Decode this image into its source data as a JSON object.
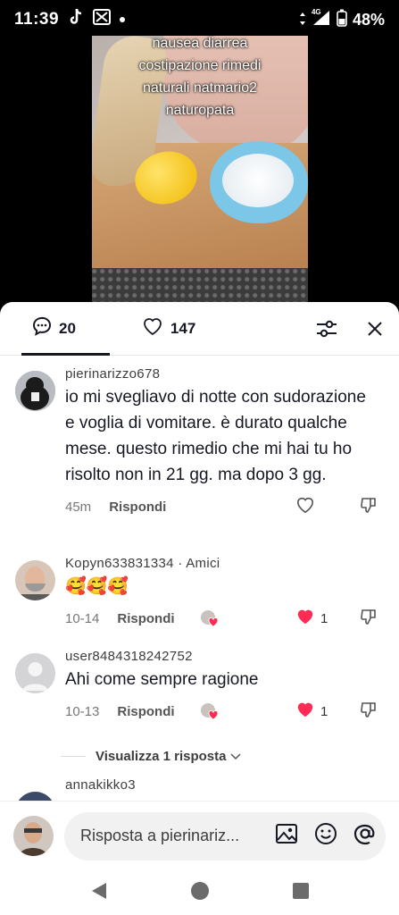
{
  "status_bar": {
    "time": "11:39",
    "network": "4G",
    "battery": "48%"
  },
  "video": {
    "caption_lines": [
      "nausea diarrea",
      "costipazione rimedi",
      "naturali natmario2",
      "naturopata"
    ]
  },
  "header": {
    "comments_count": "20",
    "likes_count": "147"
  },
  "comments": [
    {
      "username": "pierinarizzo678",
      "text": "io mi svegliavo di notte con sudorazione e voglia di vomitare. è durato qualche mese. questo rimedio che mi hai tu ho risolto non in 21 gg. ma dopo 3 gg.",
      "time": "45m",
      "reply_label": "Rispondi",
      "likes": ""
    },
    {
      "username": "Kopyn633831334 · Amici",
      "text": "🥰🥰🥰",
      "time": "10-14",
      "reply_label": "Rispondi",
      "likes": "1"
    },
    {
      "username": "user8484318242752",
      "text": "Ahi come sempre ragione",
      "time": "10-13",
      "reply_label": "Rispondi",
      "likes": "1"
    },
    {
      "username": "annakikko3"
    }
  ],
  "view_replies_label": "Visualizza 1 risposta",
  "reply_bar": {
    "placeholder": "Risposta a pierinariz..."
  },
  "colors": {
    "like_active": "#fe2c55",
    "text_primary": "#161823",
    "text_secondary": "#757575"
  }
}
